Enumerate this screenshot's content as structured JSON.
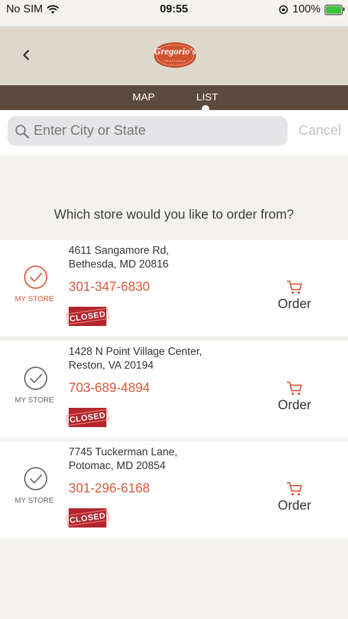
{
  "status_bar": {
    "carrier": "No SIM",
    "time": "09:55",
    "battery": "100%"
  },
  "header": {
    "logo_text": "Gregorio's",
    "logo_subtext": "TRATTORIA"
  },
  "tabs": [
    {
      "label": "MAP"
    },
    {
      "label": "LIST"
    }
  ],
  "search": {
    "placeholder": "Enter City or State",
    "value": "",
    "cancel_label": "Cancel"
  },
  "prompt": "Which store would you like to order from?",
  "stores": [
    {
      "address_line1": "4611 Sangamore Rd,",
      "address_line2": "Bethesda, MD 20816",
      "phone": "301-347-6830",
      "status": "CLOSED",
      "my_store_label": "MY STORE",
      "selected": true,
      "order_label": "Order"
    },
    {
      "address_line1": "1428 N Point Village Center,",
      "address_line2": "Reston, VA 20194",
      "phone": "703-689-4894",
      "status": "CLOSED",
      "my_store_label": "MY STORE",
      "selected": false,
      "order_label": "Order"
    },
    {
      "address_line1": "7745 Tuckerman Lane,",
      "address_line2": "Potomac, MD 20854",
      "phone": "301-296-6168",
      "status": "CLOSED",
      "my_store_label": "MY STORE",
      "selected": false,
      "order_label": "Order"
    }
  ],
  "colors": {
    "accent": "#d75a3a",
    "tab_bar": "#5b4a3d",
    "header_bg": "#ded8cc",
    "closed_badge": "#b3262e",
    "selected_check": "#d75a3a",
    "unselected_check": "#666666"
  }
}
